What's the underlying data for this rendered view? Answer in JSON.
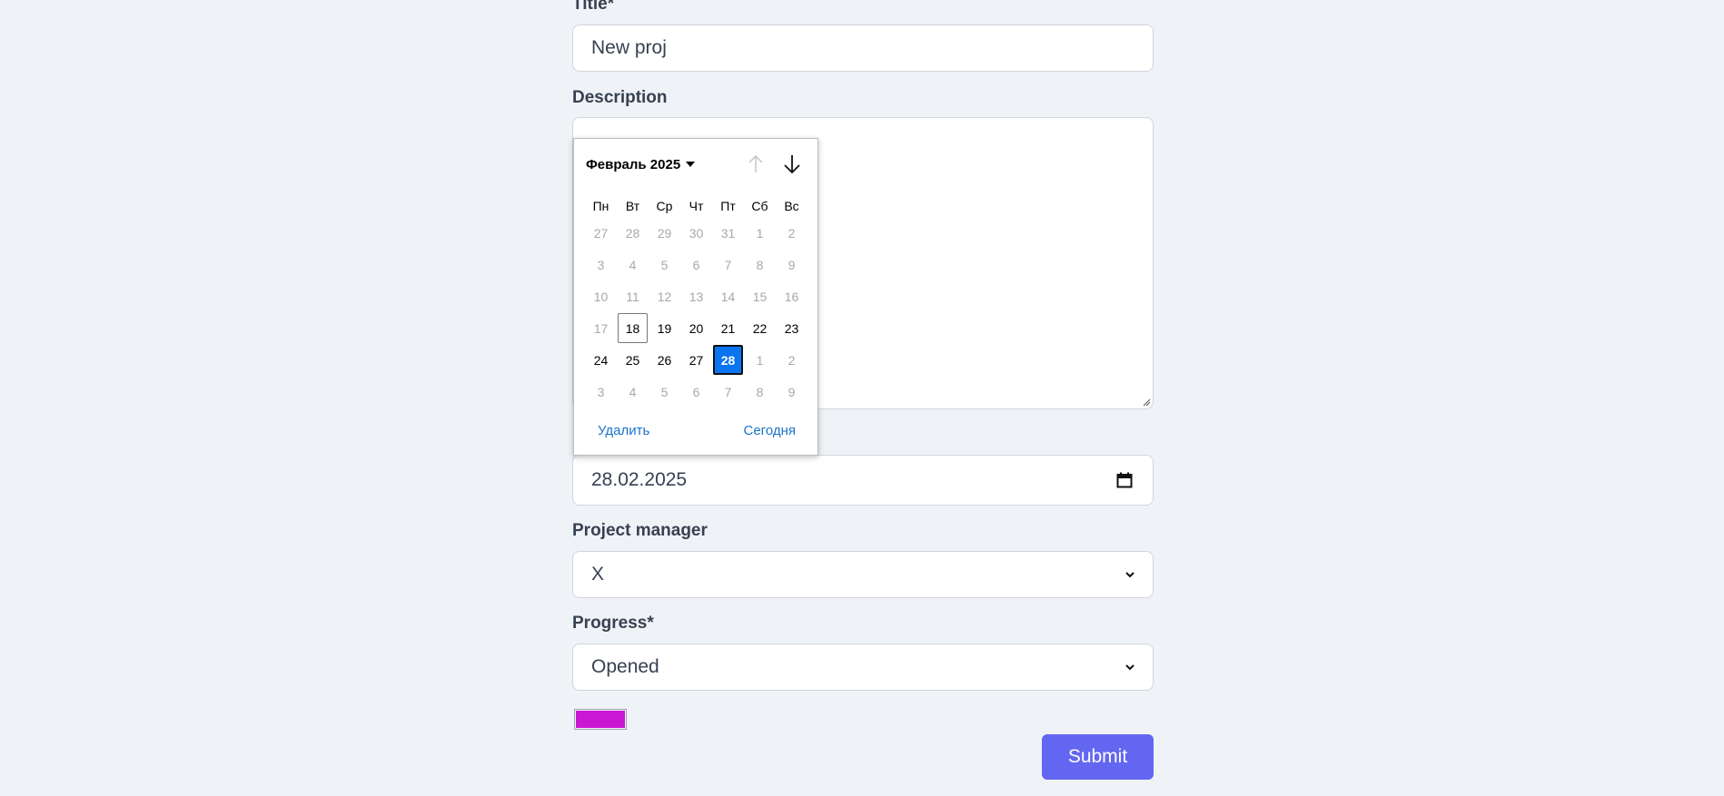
{
  "form": {
    "title_label": "Title*",
    "title_value": "New proj",
    "description_label": "Description",
    "description_value": "",
    "date_value": "28.02.2025",
    "project_manager_label": "Project manager",
    "project_manager_value": "X",
    "progress_label": "Progress*",
    "progress_value": "Opened",
    "color_value": "#c918d4",
    "submit_label": "Submit"
  },
  "datepicker": {
    "month_label": "Февраль 2025",
    "weekdays": [
      "Пн",
      "Вт",
      "Ср",
      "Чт",
      "Пт",
      "Сб",
      "Вс"
    ],
    "weeks": [
      [
        {
          "d": "27",
          "s": "muted"
        },
        {
          "d": "28",
          "s": "muted"
        },
        {
          "d": "29",
          "s": "muted"
        },
        {
          "d": "30",
          "s": "muted"
        },
        {
          "d": "31",
          "s": "muted"
        },
        {
          "d": "1",
          "s": "muted"
        },
        {
          "d": "2",
          "s": "muted"
        }
      ],
      [
        {
          "d": "3",
          "s": "muted"
        },
        {
          "d": "4",
          "s": "muted"
        },
        {
          "d": "5",
          "s": "muted"
        },
        {
          "d": "6",
          "s": "muted"
        },
        {
          "d": "7",
          "s": "muted"
        },
        {
          "d": "8",
          "s": "muted"
        },
        {
          "d": "9",
          "s": "muted"
        }
      ],
      [
        {
          "d": "10",
          "s": "muted"
        },
        {
          "d": "11",
          "s": "muted"
        },
        {
          "d": "12",
          "s": "muted"
        },
        {
          "d": "13",
          "s": "muted"
        },
        {
          "d": "14",
          "s": "muted"
        },
        {
          "d": "15",
          "s": "muted"
        },
        {
          "d": "16",
          "s": "muted"
        }
      ],
      [
        {
          "d": "17",
          "s": "muted"
        },
        {
          "d": "18",
          "s": "today"
        },
        {
          "d": "19",
          "s": ""
        },
        {
          "d": "20",
          "s": ""
        },
        {
          "d": "21",
          "s": ""
        },
        {
          "d": "22",
          "s": ""
        },
        {
          "d": "23",
          "s": ""
        }
      ],
      [
        {
          "d": "24",
          "s": ""
        },
        {
          "d": "25",
          "s": ""
        },
        {
          "d": "26",
          "s": ""
        },
        {
          "d": "27",
          "s": ""
        },
        {
          "d": "28",
          "s": "sel"
        },
        {
          "d": "1",
          "s": "muted"
        },
        {
          "d": "2",
          "s": "muted"
        }
      ],
      [
        {
          "d": "3",
          "s": "muted"
        },
        {
          "d": "4",
          "s": "muted"
        },
        {
          "d": "5",
          "s": "muted"
        },
        {
          "d": "6",
          "s": "muted"
        },
        {
          "d": "7",
          "s": "muted"
        },
        {
          "d": "8",
          "s": "muted"
        },
        {
          "d": "9",
          "s": "muted"
        }
      ]
    ],
    "clear_label": "Удалить",
    "today_label": "Сегодня",
    "selected_color": "#0b74f0",
    "link_color": "#1a73c9"
  }
}
